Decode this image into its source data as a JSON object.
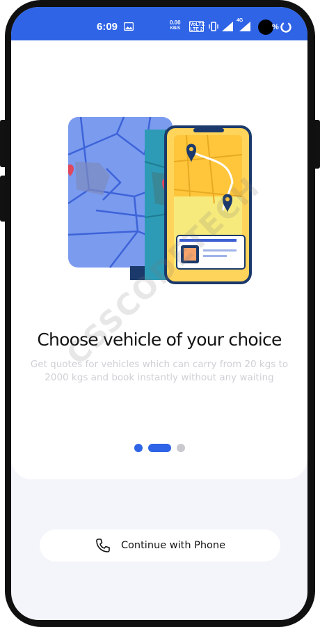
{
  "status_bar": {
    "time": "6:09",
    "net_speed_value": "0.00",
    "net_speed_unit": "KB/S",
    "volte_top": "VoLTE",
    "volte_bottom": "LTE 2",
    "network_type": "4G",
    "battery_percent": "%",
    "icons": [
      "gallery-icon",
      "vibrate-icon",
      "signal-icon",
      "signal-icon",
      "battery-ring-icon"
    ],
    "background_color": "#2f64e6"
  },
  "onboarding": {
    "illustration": "map-and-phone-illustration",
    "title": "Choose vehicle of your choice",
    "description": "Get quotes for vehicles which can carry from 20 kgs to 2000 kgs and book instantly without any waiting",
    "watermark": "CSSCODETECH",
    "pager": {
      "total": 3,
      "active_index": 1
    }
  },
  "actions": {
    "continue_label": "Continue with Phone",
    "continue_icon": "phone-icon"
  },
  "colors": {
    "accent": "#2f64e6",
    "inactive_dot": "#c9c9cf",
    "page_background": "#f4f5fa"
  }
}
